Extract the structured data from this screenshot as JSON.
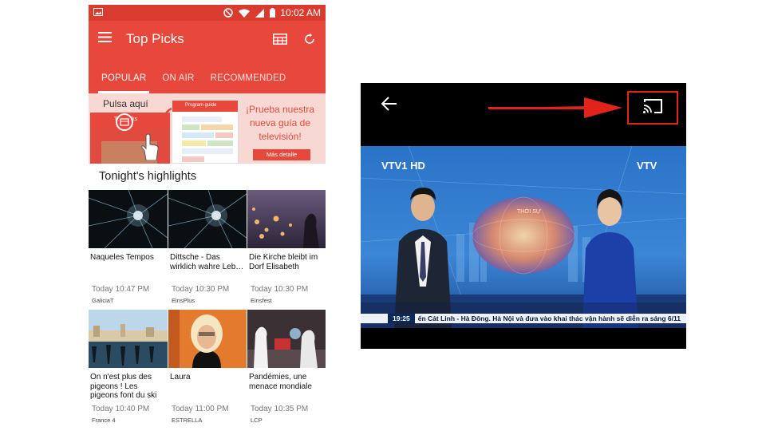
{
  "status_bar": {
    "time": "10:02 AM"
  },
  "app_bar": {
    "title": "Top Picks"
  },
  "tabs": [
    {
      "label": "POPULAR",
      "active": true
    },
    {
      "label": "ON AIR",
      "active": false
    },
    {
      "label": "RECOMMENDED",
      "active": false
    }
  ],
  "promo": {
    "tap_text": "Pulsa aquí",
    "mini_app_title": "Top picks",
    "mini_guide_title": "Program guide",
    "headline": "¡Prueba nuestra nueva guía de televisión!",
    "more_button": "Más detalle"
  },
  "section_title": "Tonight's highlights",
  "programs": [
    {
      "name": "Naqueles Tempos",
      "time": "Today 10:47 PM",
      "channel": "GaliciaT"
    },
    {
      "name": "Dittsche - Das wirklich wahre Leb…",
      "time": "Today 10:30 PM",
      "channel": "EinsPlus"
    },
    {
      "name": "Die Kirche bleibt im Dorf Elisabeth",
      "time": "Today 10:30 PM",
      "channel": "Einsfest"
    },
    {
      "name": "On n'est plus des pigeons ! Les pigeons font du ski",
      "time": "Today 10:40 PM",
      "channel": "France 4"
    },
    {
      "name": "Laura",
      "time": "Today 11:00 PM",
      "channel": "ESTRELLA"
    },
    {
      "name": "Pandémies, une menace mondiale",
      "time": "Today 10:35 PM",
      "channel": "LCP"
    }
  ],
  "player": {
    "channel_logo_left": "VTV1 HD",
    "channel_logo_right": "VTV",
    "studio_sign": "THỜI SỰ",
    "ticker_time": "19:25",
    "ticker_text": "ến Cát Linh - Hà Đông. Hà Nội và đưa vào khai thác vận hành sẽ diễn ra sáng 6/11"
  },
  "colors": {
    "brand_red": "#e8473c",
    "status_red": "#d93c2f",
    "cast_highlight": "#e2231a"
  }
}
